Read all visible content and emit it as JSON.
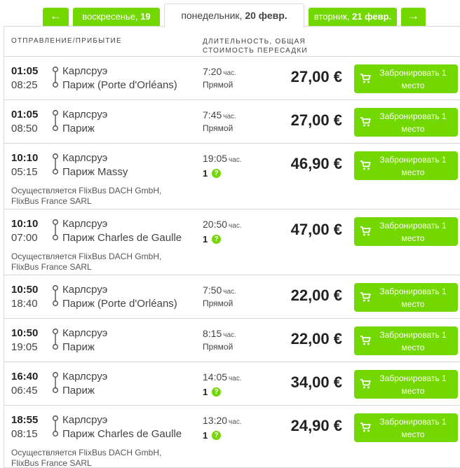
{
  "date_tabs": {
    "prev_arrow": "←",
    "next_arrow": "→",
    "prev_day": {
      "weekday": "воскресенье, ",
      "day": "19"
    },
    "current_day": {
      "weekday": "понедельник, ",
      "day": "20 февр."
    },
    "next_day": {
      "weekday": "вторник, ",
      "day": "21 февр."
    }
  },
  "table_header": {
    "col_departure": "ОТПРАВЛЕНИЕ/ПРИБЫТИЕ",
    "col_duration": "ДЛИТЕЛЬНОСТЬ, ОБЩАЯ СТОИМОСТЬ ПЕРЕСАДКИ"
  },
  "duration_unit": "час.",
  "help_symbol": "?",
  "book_label": "Забронировать 1 место",
  "colors": {
    "accent": "#73d700"
  },
  "rides": [
    {
      "dep": "01:05",
      "arr": "08:25",
      "from": "Карлсруэ",
      "to": "Париж (Porte d'Orléans)",
      "duration": "7:20",
      "transfers": "Прямой",
      "transfer_count": null,
      "operator": null,
      "price": "27,00 €"
    },
    {
      "dep": "01:05",
      "arr": "08:50",
      "from": "Карлсруэ",
      "to": "Париж",
      "duration": "7:45",
      "transfers": "Прямой",
      "transfer_count": null,
      "operator": null,
      "price": "27,00 €"
    },
    {
      "dep": "10:10",
      "arr": "05:15",
      "from": "Карлсруэ",
      "to": "Париж Massy",
      "duration": "19:05",
      "transfers": null,
      "transfer_count": "1",
      "operator": "Осуществляется FlixBus DACH GmbH, FlixBus France SARL",
      "price": "46,90 €"
    },
    {
      "dep": "10:10",
      "arr": "07:00",
      "from": "Карлсруэ",
      "to": "Париж Charles de Gaulle",
      "duration": "20:50",
      "transfers": null,
      "transfer_count": "1",
      "operator": "Осуществляется FlixBus DACH GmbH, FlixBus France SARL",
      "price": "47,00 €"
    },
    {
      "dep": "10:50",
      "arr": "18:40",
      "from": "Карлсруэ",
      "to": "Париж (Porte d'Orléans)",
      "duration": "7:50",
      "transfers": "Прямой",
      "transfer_count": null,
      "operator": null,
      "price": "22,00 €"
    },
    {
      "dep": "10:50",
      "arr": "19:05",
      "from": "Карлсруэ",
      "to": "Париж",
      "duration": "8:15",
      "transfers": "Прямой",
      "transfer_count": null,
      "operator": null,
      "price": "22,00 €"
    },
    {
      "dep": "16:40",
      "arr": "06:45",
      "from": "Карлсруэ",
      "to": "Париж",
      "duration": "14:05",
      "transfers": null,
      "transfer_count": "1",
      "operator": null,
      "price": "34,00 €"
    },
    {
      "dep": "18:55",
      "arr": "08:15",
      "from": "Карлсруэ",
      "to": "Париж Charles de Gaulle",
      "duration": "13:20",
      "transfers": null,
      "transfer_count": "1",
      "operator": "Осуществляется FlixBus DACH GmbH, FlixBus France SARL",
      "price": "24,90 €"
    }
  ]
}
